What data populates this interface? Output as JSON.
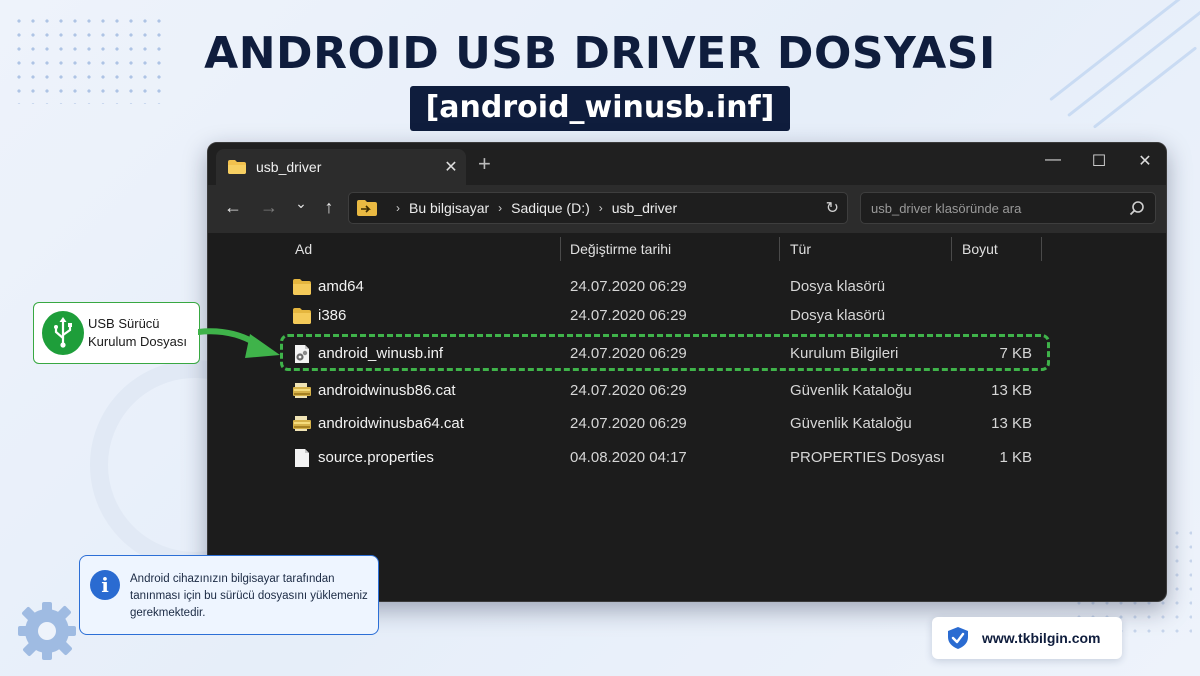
{
  "header": {
    "title": "ANDROID USB DRIVER DOSYASI",
    "subtitle": "[android_winusb.inf]"
  },
  "window": {
    "tab_title": "usb_driver",
    "tab_close": "✕",
    "new_tab": "+",
    "minimize": "—",
    "maximize": "☐",
    "close": "✕",
    "nav": {
      "back": "←",
      "forward": "→",
      "recent": "⌄",
      "up": "↑"
    },
    "breadcrumb": [
      "Bu bilgisayar",
      "Sadique (D:)",
      "usb_driver"
    ],
    "breadcrumb_sep": "›",
    "refresh": "↻",
    "search_placeholder": "usb_driver klasöründe ara",
    "columns": {
      "name": "Ad",
      "date": "Değiştirme tarihi",
      "type": "Tür",
      "size": "Boyut"
    },
    "files": [
      {
        "icon": "folder-icon",
        "name": "amd64",
        "date": "24.07.2020 06:29",
        "type": "Dosya klasörü",
        "size": ""
      },
      {
        "icon": "folder-icon",
        "name": "i386",
        "date": "24.07.2020 06:29",
        "type": "Dosya klasörü",
        "size": ""
      },
      {
        "icon": "inf-file-icon",
        "name": "android_winusb.inf",
        "date": "24.07.2020 06:29",
        "type": "Kurulum Bilgileri",
        "size": "7 KB"
      },
      {
        "icon": "catalog-file-icon",
        "name": "androidwinusb86.cat",
        "date": "24.07.2020 06:29",
        "type": "Güvenlik Kataloğu",
        "size": "13 KB"
      },
      {
        "icon": "catalog-file-icon",
        "name": "androidwinusba64.cat",
        "date": "24.07.2020 06:29",
        "type": "Güvenlik Kataloğu",
        "size": "13 KB"
      },
      {
        "icon": "document-file-icon",
        "name": "source.properties",
        "date": "04.08.2020 04:17",
        "type": "PROPERTIES Dosyası",
        "size": "1 KB"
      }
    ]
  },
  "usb_callout": {
    "line1": "USB Sürücü",
    "line2": "Kurulum Dosyası"
  },
  "info_callout": {
    "text": "Android cihazınızın bilgisayar tarafından tanınması için bu sürücü dosyasını yüklemeniz gerekmektedir."
  },
  "site": {
    "url": "www.tkbilgin.com"
  },
  "colors": {
    "highlight": "#3fb34a",
    "navy": "#0f1d3d",
    "info_blue": "#2a6bd1",
    "window_bg": "#1c1c1c"
  }
}
